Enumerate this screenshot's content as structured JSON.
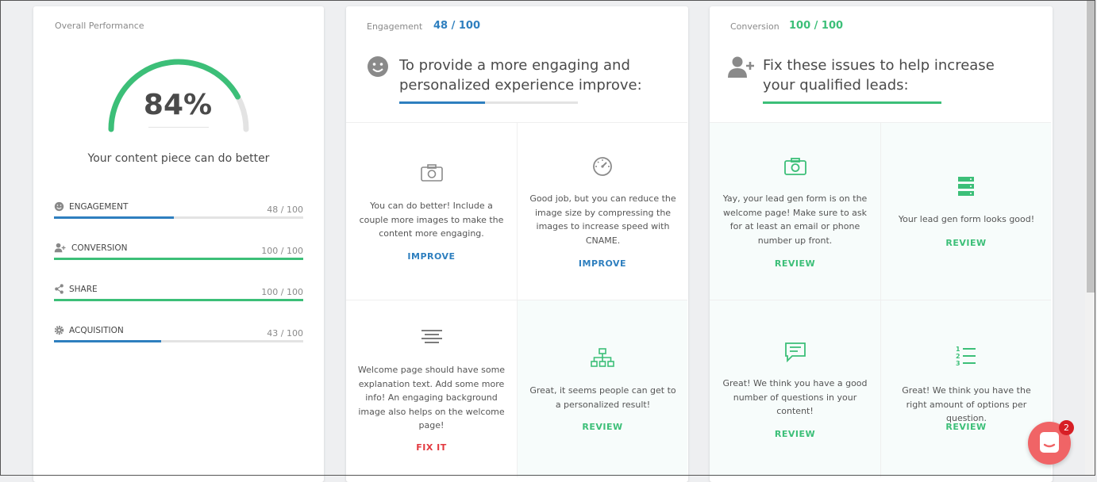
{
  "colors": {
    "blue": "#2e7fbf",
    "green": "#3cbf78",
    "red": "#e2393f",
    "track": "#e3e3e3"
  },
  "overall": {
    "title": "Overall Performance",
    "score_text": "84%",
    "score": 84,
    "message": "Your content piece can do better",
    "metrics": [
      {
        "label": "ENGAGEMENT",
        "score_text": "48 / 100",
        "value": 48,
        "color": "#2e7fbf",
        "icon": "smile-icon"
      },
      {
        "label": "CONVERSION",
        "score_text": "100 / 100",
        "value": 100,
        "color": "#3cbf78",
        "icon": "add-user-icon"
      },
      {
        "label": "SHARE",
        "score_text": "100 / 100",
        "value": 100,
        "color": "#3cbf78",
        "icon": "share-icon"
      },
      {
        "label": "ACQUISITION",
        "score_text": "43 / 100",
        "value": 43,
        "color": "#2e7fbf",
        "icon": "gear-icon"
      }
    ]
  },
  "engagement": {
    "label": "Engagement",
    "score_text": "48 / 100",
    "value": 48,
    "heading": [
      "To provide a more engaging and",
      "personalized experience improve:"
    ],
    "cells": [
      {
        "icon": "camera-icon",
        "text": "You can do better! Include a couple more images to make the content more engaging.",
        "action": "IMPROVE"
      },
      {
        "icon": "speedometer-icon",
        "text": "Good job, but you can reduce the image size by compressing the images to increase speed with CNAME.",
        "action": "IMPROVE"
      },
      {
        "icon": "text-lines-icon",
        "text": "Welcome page should have some explanation text. Add some more info! An engaging background image also helps on the welcome page!",
        "action": "FIX IT"
      },
      {
        "icon": "sitemap-icon",
        "text": "Great, it seems people can get to a personalized result!",
        "action": "REVIEW"
      }
    ]
  },
  "conversion": {
    "label": "Conversion",
    "score_text": "100 / 100",
    "value": 100,
    "heading": [
      "Fix these issues to help increase",
      "your qualified leads:"
    ],
    "cells": [
      {
        "icon": "camera-icon",
        "text": "Yay, your lead gen form is on the welcome page! Make sure to ask for at least an email or phone number up front.",
        "action": "REVIEW"
      },
      {
        "icon": "form-icon",
        "text": "Your lead gen form looks good!",
        "action": "REVIEW"
      },
      {
        "icon": "comment-icon",
        "text": "Great! We think you have a good number of questions in your content!",
        "action": "REVIEW"
      },
      {
        "icon": "numbered-list-icon",
        "text": "Great! We think you have the right amount of options per question.",
        "action": "REVIEW"
      }
    ]
  },
  "chat": {
    "badge": "2"
  }
}
